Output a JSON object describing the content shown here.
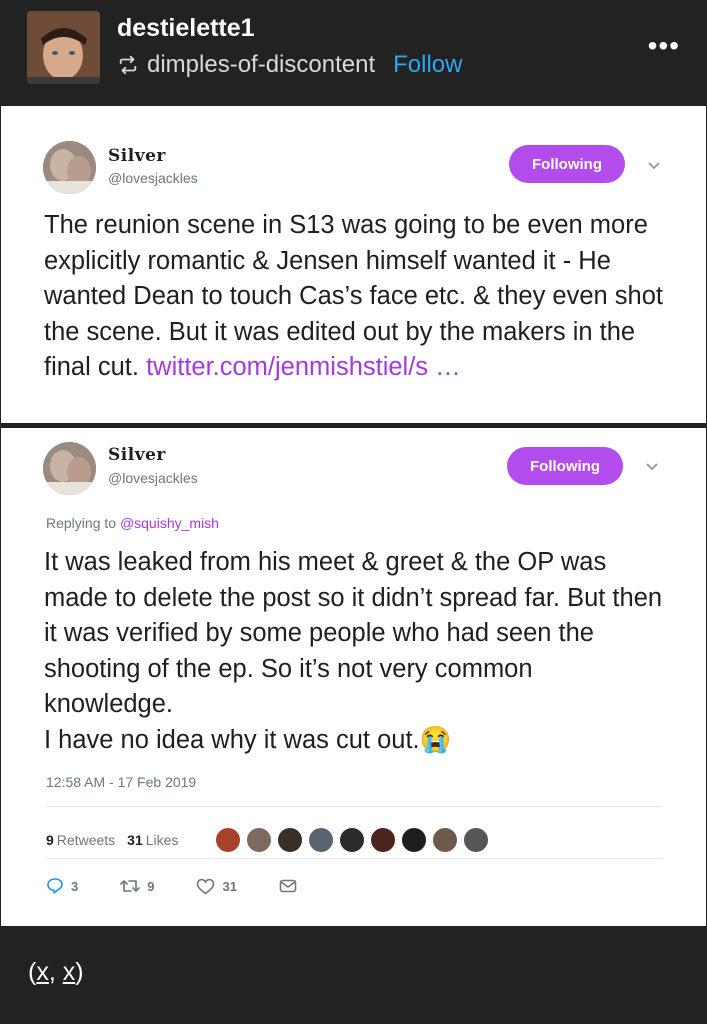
{
  "header": {
    "username": "destielette1",
    "reblog_from": "dimples-of-discontent",
    "follow_label": "Follow",
    "more_label": "•••"
  },
  "tweets": [
    {
      "display_name": "Silver",
      "handle": "@lovesjackles",
      "follow_button": "Following",
      "body": "The reunion scene in S13 was going to be even more explicitly romantic & Jensen himself wanted it - He wanted Dean to touch Cas’s face etc. & they even shot the scene. But it was edited out by the makers in the final cut.",
      "link": "twitter.com/jenmishstiel/s …"
    },
    {
      "display_name": "Silver",
      "handle": "@lovesjackles",
      "follow_button": "Following",
      "replying_prefix": "Replying to",
      "replying_to": "@squishy_mish",
      "body": "It was leaked from his meet & greet & the OP was made to delete the post so it didn’t spread far. But then it was verified by some people who had seen the shooting of the ep. So it’s not very common knowledge.",
      "body_last_line": "I have no idea why it was cut out.",
      "emoji": "😭",
      "timestamp": "12:58 AM - 17 Feb 2019",
      "retweets_count": "9",
      "retweets_label": "Retweets",
      "likes_count": "31",
      "likes_label": "Likes",
      "actions": {
        "reply_count": "3",
        "retweet_count": "9",
        "like_count": "31"
      }
    }
  ],
  "footer": {
    "open": "(",
    "first": "x",
    "comma": ", ",
    "second": "x",
    "close": ")"
  },
  "colors": {
    "background": "#222222",
    "follow_link": "#2fa6f2",
    "following_button": "#b34ced",
    "tweet_link": "#a13be0"
  }
}
